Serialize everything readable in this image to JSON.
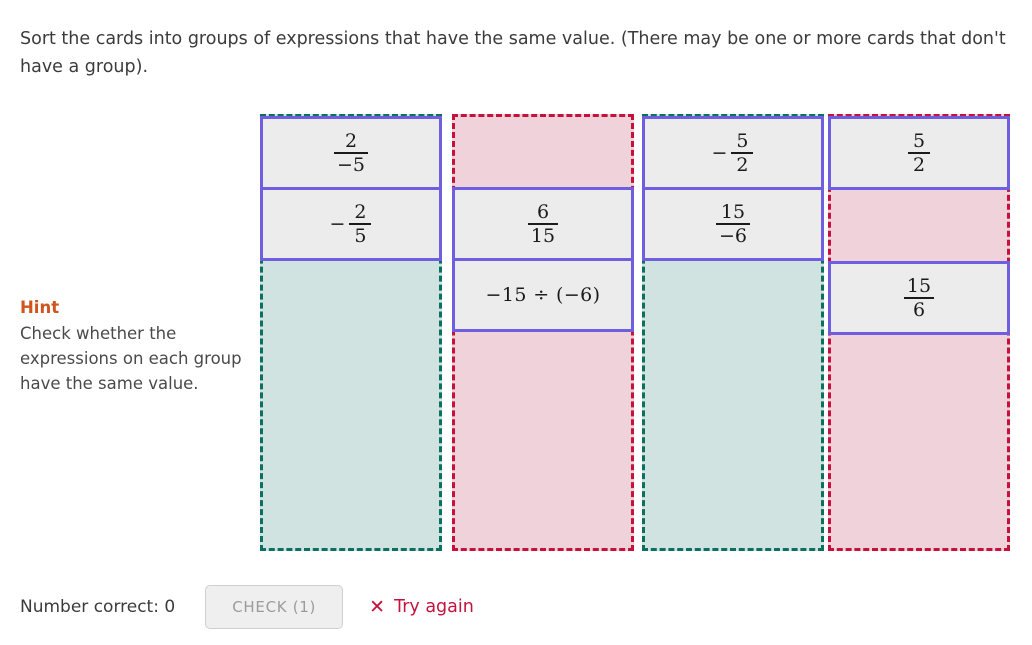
{
  "prompt": {
    "text": "Sort the cards into groups of expressions that have the same value. (There may be one or more cards that don't have a group)."
  },
  "hint": {
    "title": "Hint",
    "body": "Check whether the expressions on each group have the same value.",
    "title_color": "#d1541e"
  },
  "colors": {
    "correct_border": "#0b7060",
    "correct_fill": "#d1e3e0",
    "incorrect_border": "#c4123c",
    "incorrect_fill": "#f0d2da",
    "card_border": "#6f5fe0",
    "card_fill": "#ececec"
  },
  "groups": [
    {
      "id": "group-1",
      "status": "correct",
      "slots": [
        {
          "type": "card",
          "kind": "fraction",
          "numerator": "2",
          "denominator": "−5",
          "sign": "",
          "text": "2/−5"
        },
        {
          "type": "card",
          "kind": "fraction",
          "numerator": "2",
          "denominator": "5",
          "sign": "−",
          "text": "−2/5"
        }
      ]
    },
    {
      "id": "group-2",
      "status": "incorrect",
      "slots": [
        {
          "type": "empty"
        },
        {
          "type": "card",
          "kind": "fraction",
          "numerator": "6",
          "denominator": "15",
          "sign": "",
          "text": "6/15"
        },
        {
          "type": "card",
          "kind": "plain",
          "text": "−15 ÷ (−6)"
        }
      ]
    },
    {
      "id": "group-3",
      "status": "correct",
      "slots": [
        {
          "type": "card",
          "kind": "fraction",
          "numerator": "5",
          "denominator": "2",
          "sign": "−",
          "text": "−5/2"
        },
        {
          "type": "card",
          "kind": "fraction",
          "numerator": "15",
          "denominator": "−6",
          "sign": "",
          "text": "15/−6"
        }
      ]
    },
    {
      "id": "group-4",
      "status": "incorrect",
      "slots": [
        {
          "type": "card",
          "kind": "fraction",
          "numerator": "5",
          "denominator": "2",
          "sign": "",
          "text": "5/2"
        },
        {
          "type": "empty"
        },
        {
          "type": "card",
          "kind": "fraction",
          "numerator": "15",
          "denominator": "6",
          "sign": "",
          "text": "15/6"
        }
      ]
    }
  ],
  "footer": {
    "number_correct_label": "Number correct: 0",
    "check_button_label": "CHECK (1)",
    "feedback_icon": "✕",
    "feedback_text": "Try again"
  }
}
